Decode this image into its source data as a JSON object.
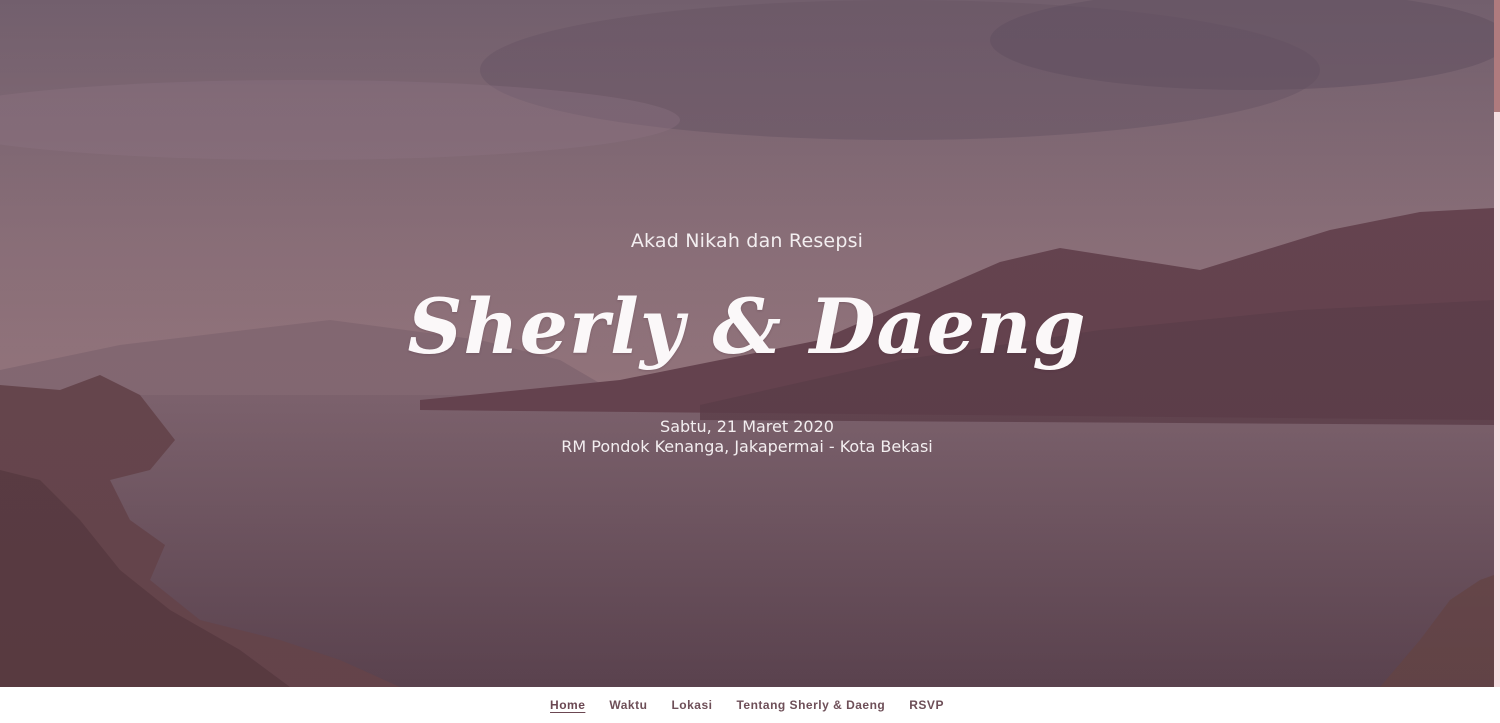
{
  "hero": {
    "event_type": "Akad Nikah dan Resepsi",
    "couple_names": "Sherly & Daeng",
    "date": "Sabtu, 21 Maret 2020",
    "venue": "RM Pondok Kenanga, Jakapermai - Kota Bekasi",
    "background": "lake-mountain-landscape"
  },
  "nav": {
    "items": [
      {
        "label": "Home",
        "active": true
      },
      {
        "label": "Waktu",
        "active": false
      },
      {
        "label": "Lokasi",
        "active": false
      },
      {
        "label": "Tentang Sherly & Daeng",
        "active": false
      },
      {
        "label": "RSVP",
        "active": false
      }
    ]
  },
  "colors": {
    "overlay": "#7c6570",
    "nav_text": "#6e4f58",
    "scroll_thumb": "#b07b7e",
    "scroll_track": "#f6dfe2"
  }
}
